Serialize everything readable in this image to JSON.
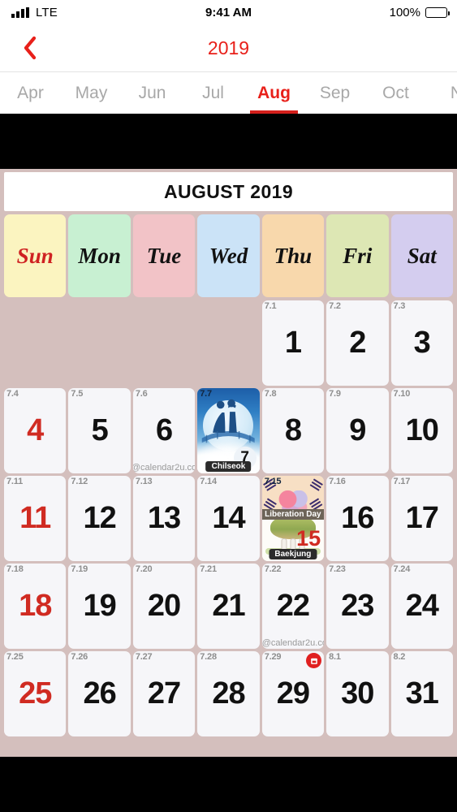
{
  "status_bar": {
    "carrier": "LTE",
    "time": "9:41 AM",
    "battery_pct": "100%"
  },
  "nav": {
    "back_icon": "chevron-left-icon",
    "title": "2019",
    "accent_color": "#e8201a"
  },
  "month_tabs": {
    "items": [
      {
        "label": "Apr",
        "active": false
      },
      {
        "label": "May",
        "active": false
      },
      {
        "label": "Jun",
        "active": false
      },
      {
        "label": "Jul",
        "active": false
      },
      {
        "label": "Aug",
        "active": true
      },
      {
        "label": "Sep",
        "active": false
      },
      {
        "label": "Oct",
        "active": false
      },
      {
        "label": "N",
        "active": false
      }
    ]
  },
  "calendar": {
    "title": "AUGUST 2019",
    "watermark": "@calendar2u.com",
    "background_color": "#d4bfbd",
    "weekdays": [
      {
        "label": "Sun",
        "color": "#fbf4c0"
      },
      {
        "label": "Mon",
        "color": "#c8f0d2"
      },
      {
        "label": "Tue",
        "color": "#f2c3c7"
      },
      {
        "label": "Wed",
        "color": "#cbe3f7"
      },
      {
        "label": "Thu",
        "color": "#f8d8ac"
      },
      {
        "label": "Fri",
        "color": "#dde7b4"
      },
      {
        "label": "Sat",
        "color": "#d4cdef"
      }
    ],
    "weeks": [
      [
        {
          "empty": true
        },
        {
          "empty": true
        },
        {
          "empty": true
        },
        {
          "empty": true
        },
        {
          "day": "1",
          "lunar": "7.1",
          "holiday": false
        },
        {
          "day": "2",
          "lunar": "7.2",
          "holiday": false
        },
        {
          "day": "3",
          "lunar": "7.3",
          "holiday": false
        }
      ],
      [
        {
          "day": "4",
          "lunar": "7.4",
          "holiday": true
        },
        {
          "day": "5",
          "lunar": "7.5",
          "holiday": false
        },
        {
          "day": "6",
          "lunar": "7.6",
          "holiday": false,
          "watermark": "@calendar2u.com"
        },
        {
          "day": "7",
          "lunar": "7.7",
          "holiday": false,
          "event": "chilseok",
          "event_label": "Chilseok"
        },
        {
          "day": "8",
          "lunar": "7.8",
          "holiday": false
        },
        {
          "day": "9",
          "lunar": "7.9",
          "holiday": false
        },
        {
          "day": "10",
          "lunar": "7.10",
          "holiday": false
        }
      ],
      [
        {
          "day": "11",
          "lunar": "7.11",
          "holiday": true
        },
        {
          "day": "12",
          "lunar": "7.12",
          "holiday": false
        },
        {
          "day": "13",
          "lunar": "7.13",
          "holiday": false
        },
        {
          "day": "14",
          "lunar": "7.14",
          "holiday": false
        },
        {
          "day": "15",
          "lunar": "7.15",
          "holiday": true,
          "event": "liberation-baekjung",
          "event_label": "Liberation Day",
          "event_label2": "Baekjung"
        },
        {
          "day": "16",
          "lunar": "7.16",
          "holiday": false
        },
        {
          "day": "17",
          "lunar": "7.17",
          "holiday": false
        }
      ],
      [
        {
          "day": "18",
          "lunar": "7.18",
          "holiday": true
        },
        {
          "day": "19",
          "lunar": "7.19",
          "holiday": false
        },
        {
          "day": "20",
          "lunar": "7.20",
          "holiday": false
        },
        {
          "day": "21",
          "lunar": "7.21",
          "holiday": false
        },
        {
          "day": "22",
          "lunar": "7.22",
          "holiday": false,
          "watermark": "@calendar2u.com"
        },
        {
          "day": "23",
          "lunar": "7.23",
          "holiday": false
        },
        {
          "day": "24",
          "lunar": "7.24",
          "holiday": false
        }
      ],
      [
        {
          "day": "25",
          "lunar": "7.25",
          "holiday": true
        },
        {
          "day": "26",
          "lunar": "7.26",
          "holiday": false
        },
        {
          "day": "27",
          "lunar": "7.27",
          "holiday": false
        },
        {
          "day": "28",
          "lunar": "7.28",
          "holiday": false
        },
        {
          "day": "29",
          "lunar": "7.29",
          "holiday": false,
          "badge": "calendar-icon"
        },
        {
          "day": "30",
          "lunar": "8.1",
          "holiday": false
        },
        {
          "day": "31",
          "lunar": "8.2",
          "holiday": false
        }
      ]
    ]
  }
}
